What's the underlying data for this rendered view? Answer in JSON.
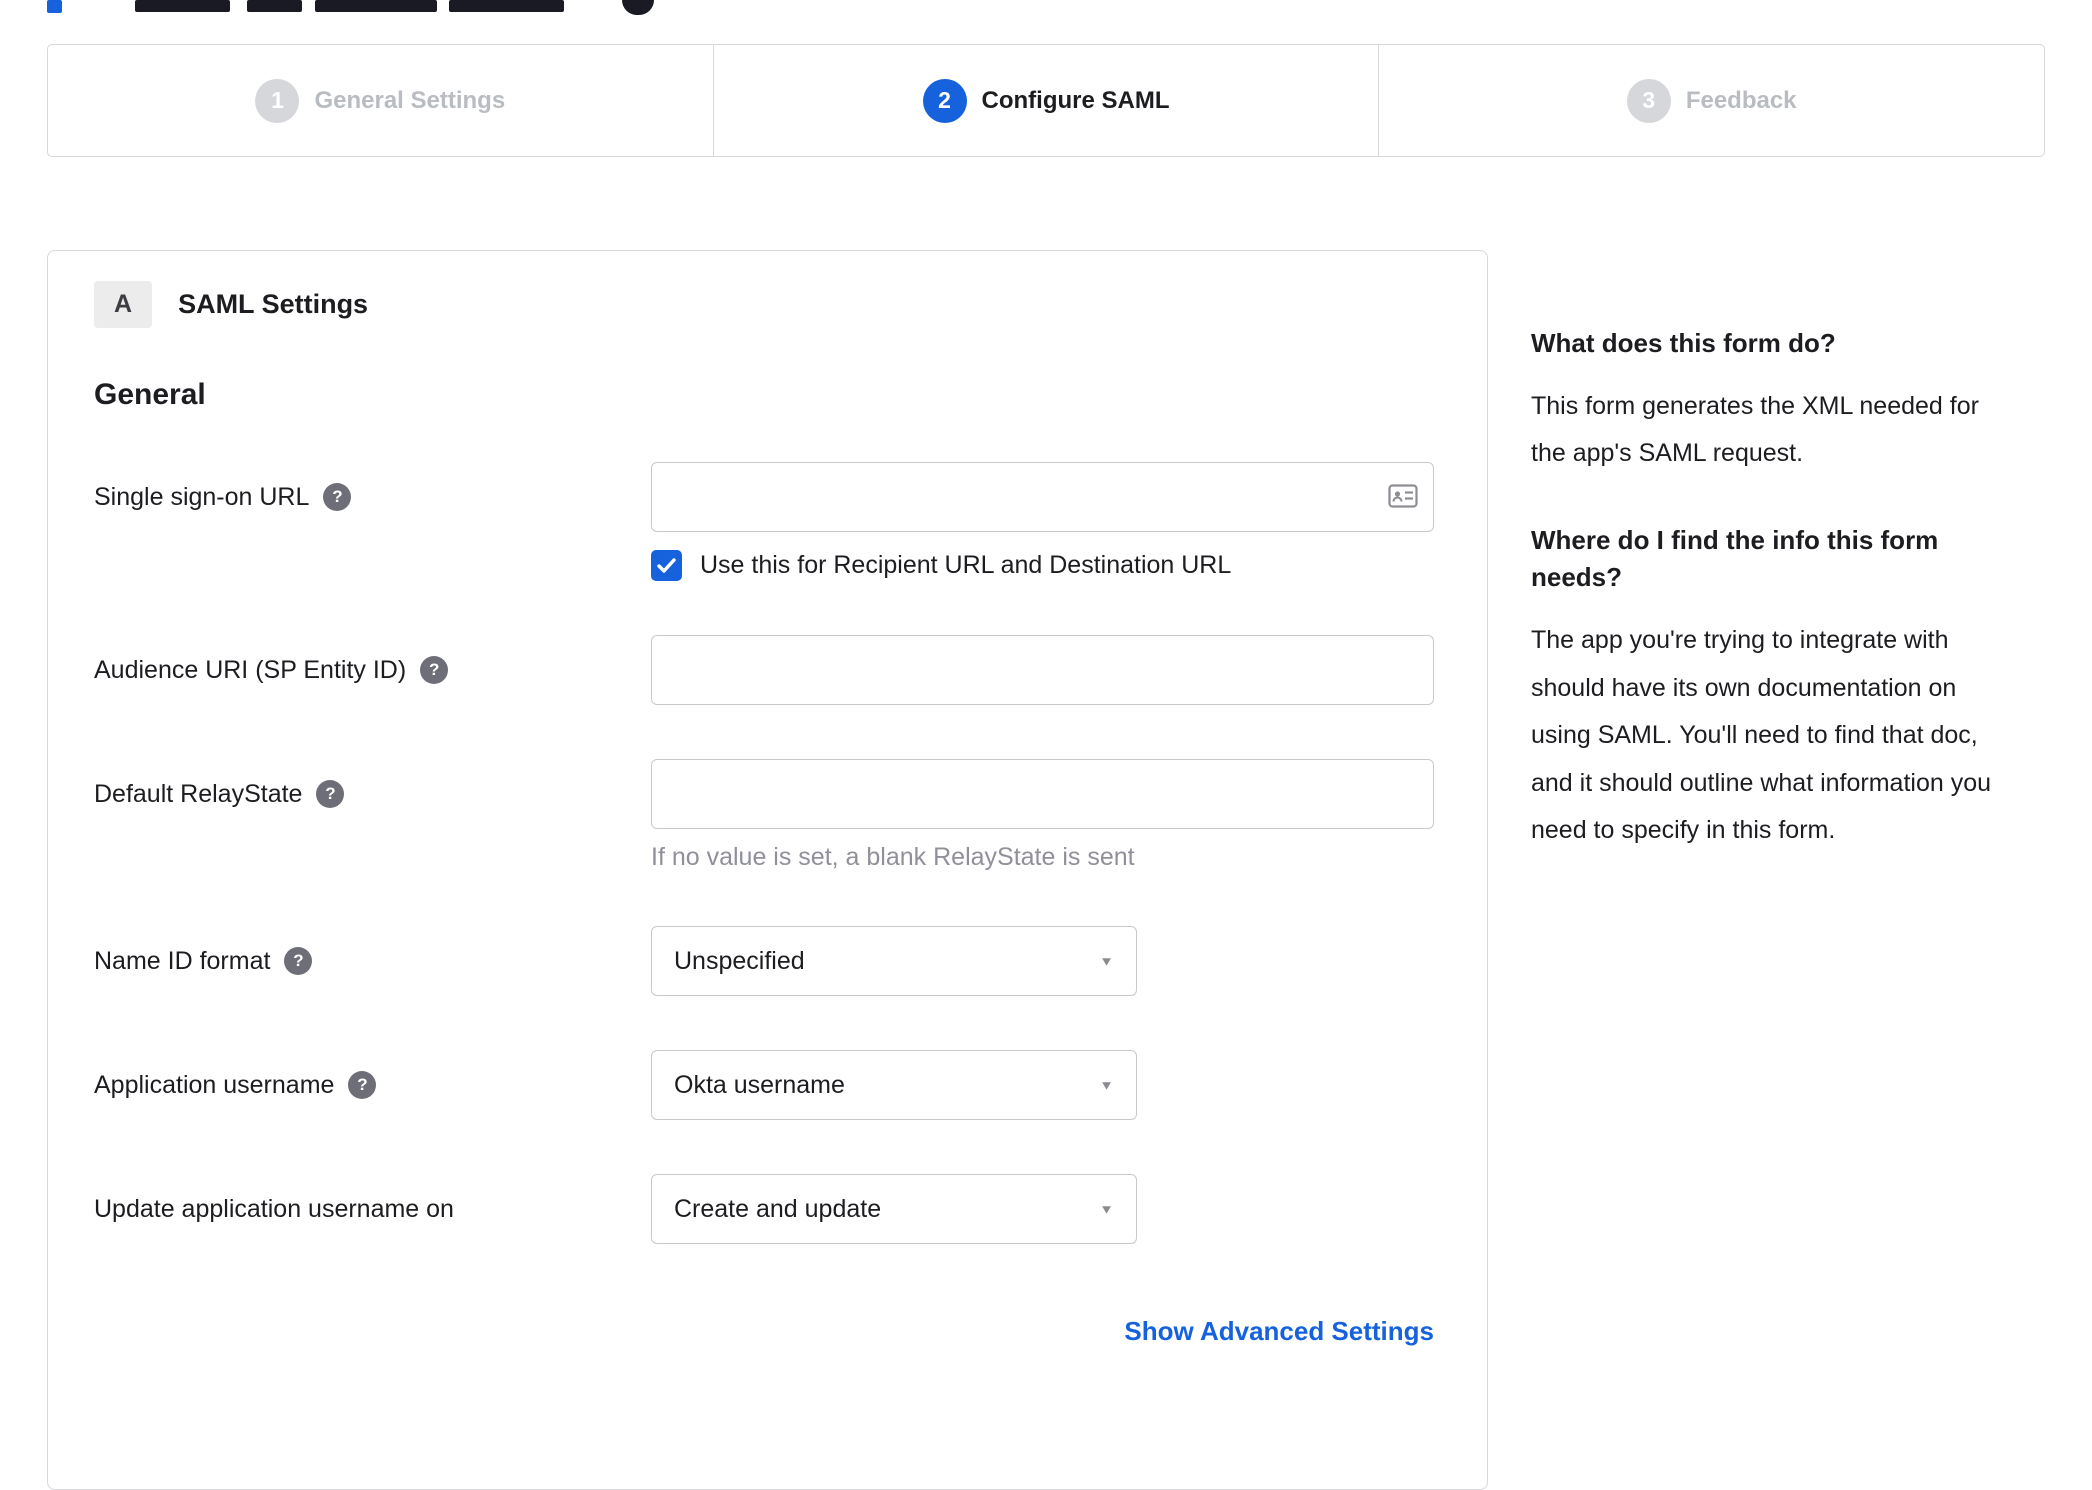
{
  "colors": {
    "accent_blue": "#1662dd",
    "link_blue": "#1662dd",
    "step_inactive_circle": "#d5d7da",
    "step_inactive_label": "#b9bcc0",
    "text_dark": "#1d1d21"
  },
  "icons": {
    "help_glyph": "?",
    "caret_glyph": "▼"
  },
  "stepper": {
    "steps": [
      {
        "number": "1",
        "label": "General Settings",
        "state": "inactive"
      },
      {
        "number": "2",
        "label": "Configure SAML",
        "state": "active"
      },
      {
        "number": "3",
        "label": "Feedback",
        "state": "inactive"
      }
    ]
  },
  "panel": {
    "section_badge": "A",
    "section_title": "SAML Settings",
    "group_title": "General",
    "fields": {
      "sso_url": {
        "label": "Single sign-on URL",
        "value": ""
      },
      "sso_checkbox": {
        "label": "Use this for Recipient URL and Destination URL",
        "checked": true
      },
      "audience_uri": {
        "label": "Audience URI (SP Entity ID)",
        "value": ""
      },
      "relay_state": {
        "label": "Default RelayState",
        "value": "",
        "help_text": "If no value is set, a blank RelayState is sent"
      },
      "name_id_format": {
        "label": "Name ID format",
        "value": "Unspecified"
      },
      "app_username": {
        "label": "Application username",
        "value": "Okta username"
      },
      "update_app_username": {
        "label": "Update application username on",
        "value": "Create and update"
      }
    },
    "advanced_link": "Show Advanced Settings"
  },
  "sidebar": {
    "sections": [
      {
        "heading": "What does this form do?",
        "body": "This form generates the XML needed for the app's SAML request."
      },
      {
        "heading": "Where do I find the info this form needs?",
        "body": "The app you're trying to integrate with should have its own documentation on using SAML. You'll need to find that doc, and it should outline what information you need to specify in this form."
      }
    ]
  }
}
